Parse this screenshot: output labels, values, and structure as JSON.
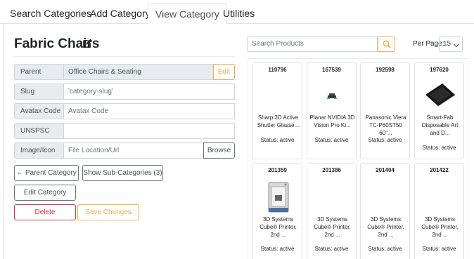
{
  "tabs": [
    {
      "label": "Search Categories"
    },
    {
      "label": "Add Category"
    },
    {
      "label": "View Category"
    },
    {
      "label": "Utilities"
    }
  ],
  "category": {
    "title": "Fabric Chairs",
    "fields": {
      "parent": {
        "label": "Parent",
        "value": "Office Chairs & Seating",
        "button": "Edit"
      },
      "slug": {
        "label": "Slug",
        "value": "'category-slug'"
      },
      "avatax": {
        "label": "Avatax Code",
        "placeholder": "Avatax Code"
      },
      "unspsc": {
        "label": "UNSPSC",
        "value": ""
      },
      "image": {
        "label": "Image/Icon",
        "placeholder": "File Location/Url",
        "button": "Browse"
      }
    },
    "buttons": {
      "parent_category": "Parent Category",
      "show_sub": "Show Sub-Categories (3)",
      "edit": "Edit Category",
      "delete": "Delete",
      "save": "Save Changes"
    }
  },
  "products_panel": {
    "search_placeholder": "Search Products",
    "per_page_label": "Per Page:",
    "per_page_value": "15",
    "products": [
      {
        "id": "110796",
        "name": "Sharp 3D Active Shutter Glasse...",
        "status": "Status: active",
        "image": "none"
      },
      {
        "id": "167539",
        "name": "Planar NVIDIA 3D Vision Pro Ki...",
        "status": "Status: active",
        "image": "small-device"
      },
      {
        "id": "192598",
        "name": "Panasonic Viera TC-P60ST50 60\"...",
        "status": "Status: active",
        "image": "none"
      },
      {
        "id": "197620",
        "name": "Smart-Fab Disposable Art and D...",
        "status": "Status: active",
        "image": "black-mat"
      },
      {
        "id": "201359",
        "name": "3D Systems Cube® Printer, 2nd ...",
        "status": "Status: active",
        "image": "3d-printer"
      },
      {
        "id": "201386",
        "name": "3D Systems Cube® Printer, 2nd ...",
        "status": "Status: active",
        "image": "none"
      },
      {
        "id": "201404",
        "name": "3D Systems Cube® Printer, 2nd ...",
        "status": "Status: active",
        "image": "none"
      },
      {
        "id": "201422",
        "name": "3D Systems Cube® Printer, 2nd ...",
        "status": "Status: active",
        "image": "none"
      }
    ]
  },
  "colors": {
    "accent_orange": "#f0ad4e",
    "danger_red": "#dc3545"
  }
}
